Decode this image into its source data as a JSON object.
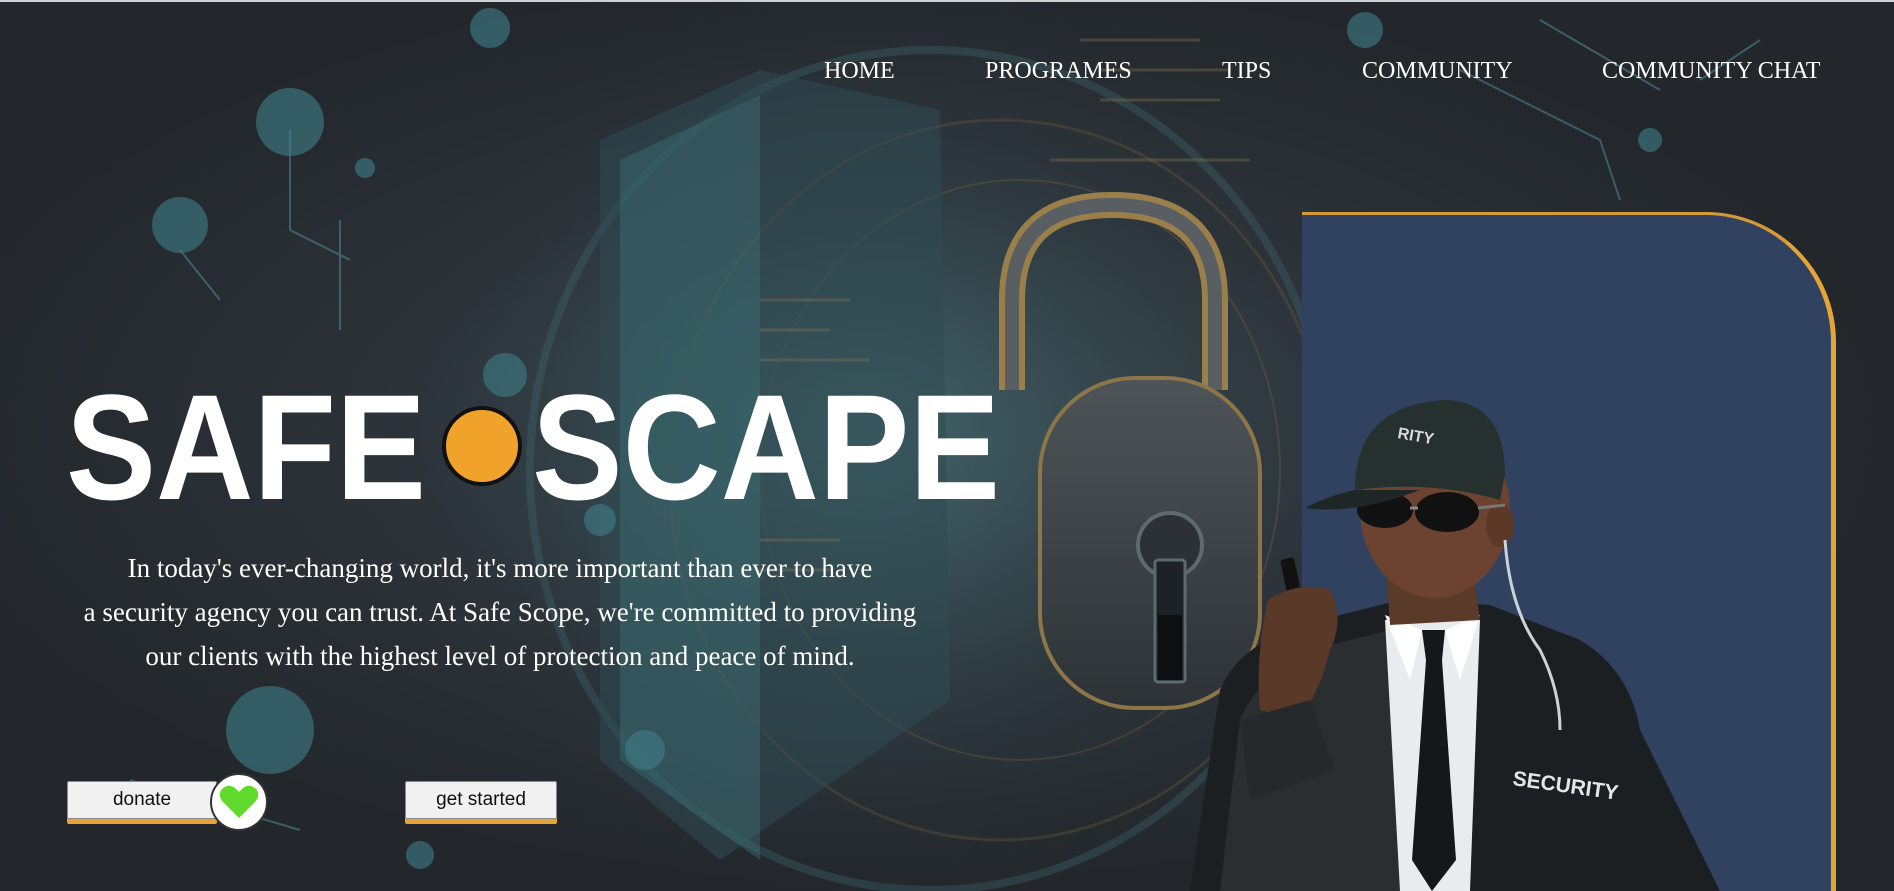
{
  "nav": {
    "home": "HOME",
    "programes": "PROGRAMES",
    "tips": "TIPS",
    "community": "COMMUNITY",
    "community_chat": "COMMUNITY CHAT"
  },
  "hero": {
    "logo_word_left": "SAFE",
    "logo_word_right": "SCAPE",
    "tagline_line1": "In today's ever-changing world, it's more important than ever to have",
    "tagline_line2": "a security agency you can trust. At Safe Scope, we're committed to providing",
    "tagline_line3": "our clients with the highest level of protection and peace of mind.",
    "donate_label": "donate",
    "get_started_label": "get started",
    "cap_text": "RITY",
    "jacket_text": "SECURITY"
  },
  "colors": {
    "accent_orange": "#f0a22a",
    "panel_blue": "#304260",
    "heart_green": "#5fd92a",
    "background": "#24272c"
  },
  "icons": [
    "heart-icon",
    "padlock-illustration",
    "security-guard-photo"
  ]
}
